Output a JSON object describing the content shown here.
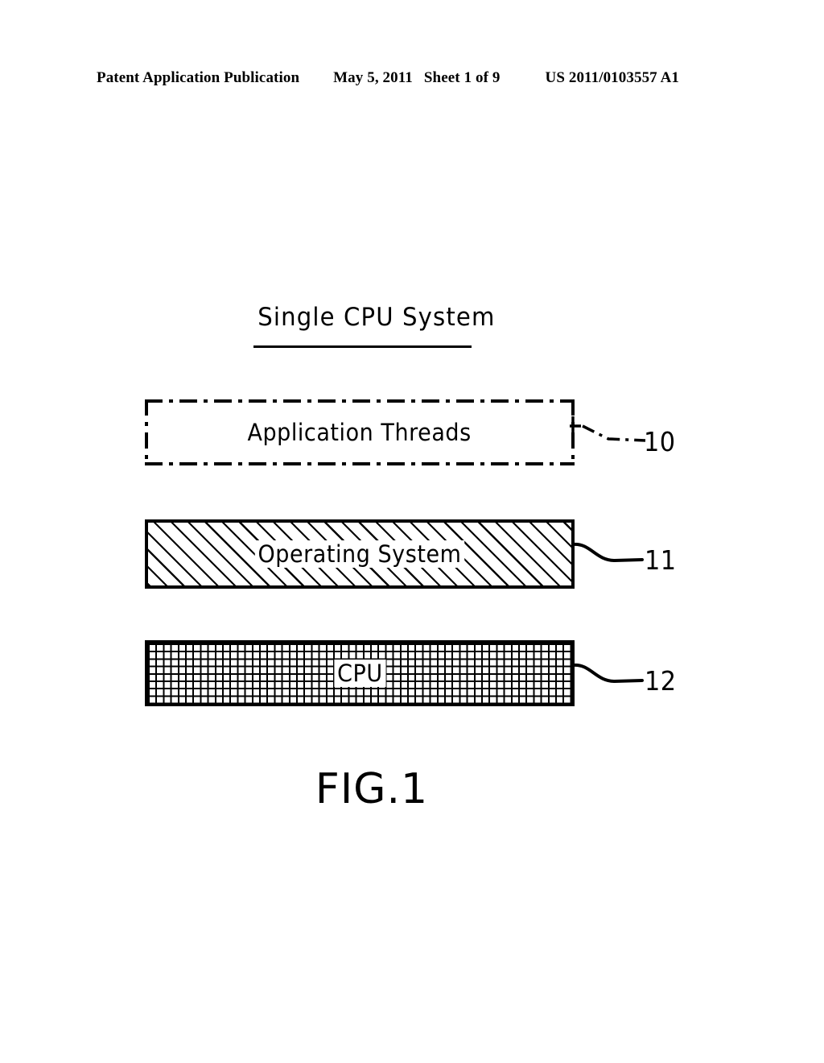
{
  "page": {
    "background_color": "#ffffff",
    "ink_color": "#000000"
  },
  "header": {
    "publication": "Patent Application Publication",
    "date": "May 5, 2011",
    "sheet": "Sheet 1 of 9",
    "publication_number": "US 2011/0103557 A1"
  },
  "figure": {
    "caption": "FIG.1",
    "title": "Single  CPU  System",
    "blocks": [
      {
        "id": "application-threads",
        "label": "Application  Threads",
        "reference_numeral": "10",
        "border_style": "dash-dot",
        "fill_pattern": "none"
      },
      {
        "id": "operating-system",
        "label": "Operating  System",
        "reference_numeral": "11",
        "border_style": "solid",
        "fill_pattern": "diagonal-hatch"
      },
      {
        "id": "cpu",
        "label": "CPU",
        "reference_numeral": "12",
        "border_style": "solid",
        "fill_pattern": "cross-hatch-grid"
      }
    ]
  }
}
